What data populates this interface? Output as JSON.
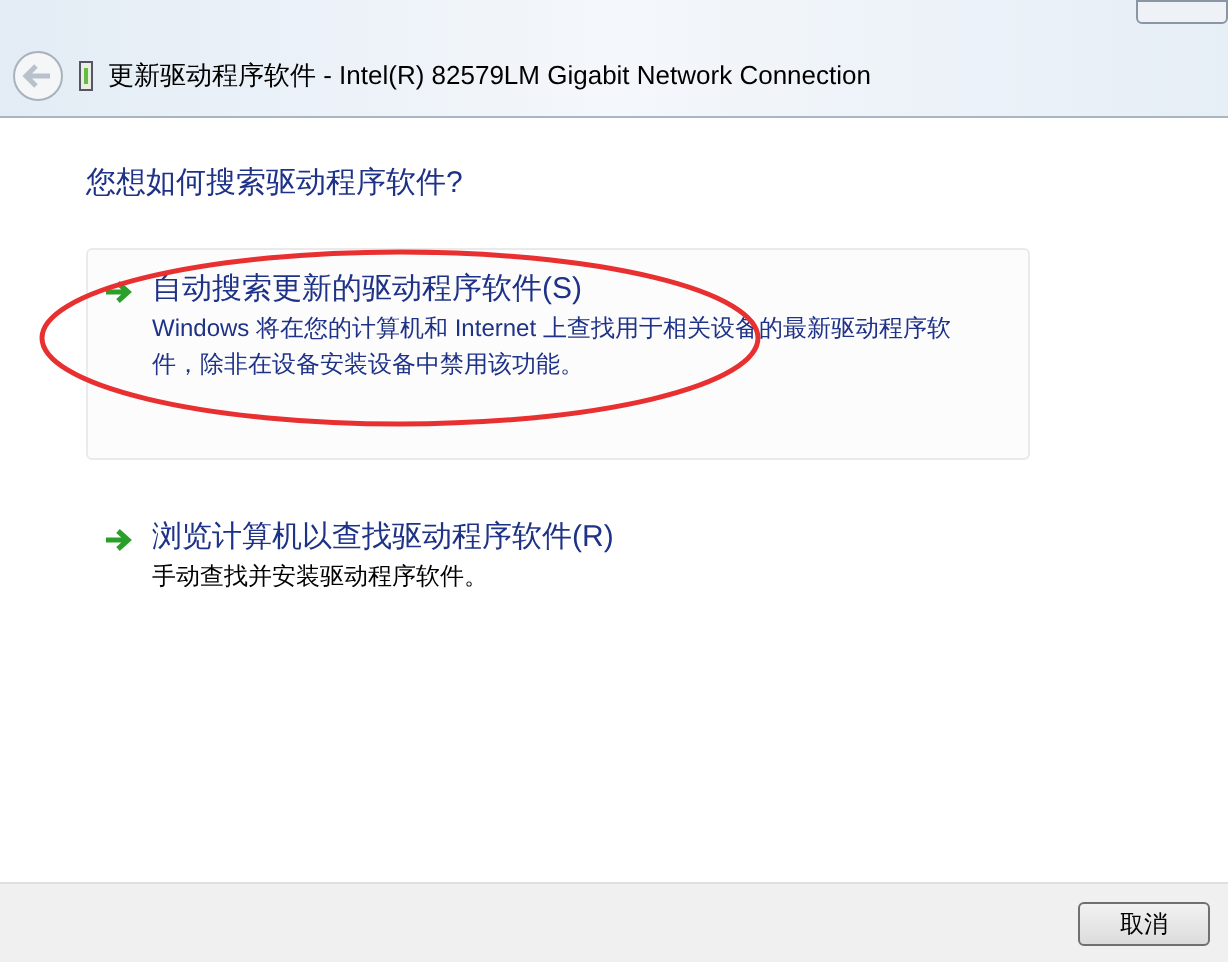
{
  "window": {
    "title": "更新驱动程序软件 - Intel(R) 82579LM Gigabit Network Connection"
  },
  "heading": "您想如何搜索驱动程序软件?",
  "options": [
    {
      "title": "自动搜索更新的驱动程序软件(S)",
      "description": "Windows 将在您的计算机和 Internet 上查找用于相关设备的最新驱动程序软件，除非在设备安装设备中禁用该功能。",
      "selected": true
    },
    {
      "title": "浏览计算机以查找驱动程序软件(R)",
      "description": "手动查找并安装驱动程序软件。",
      "selected": false
    }
  ],
  "buttons": [
    "取消"
  ]
}
